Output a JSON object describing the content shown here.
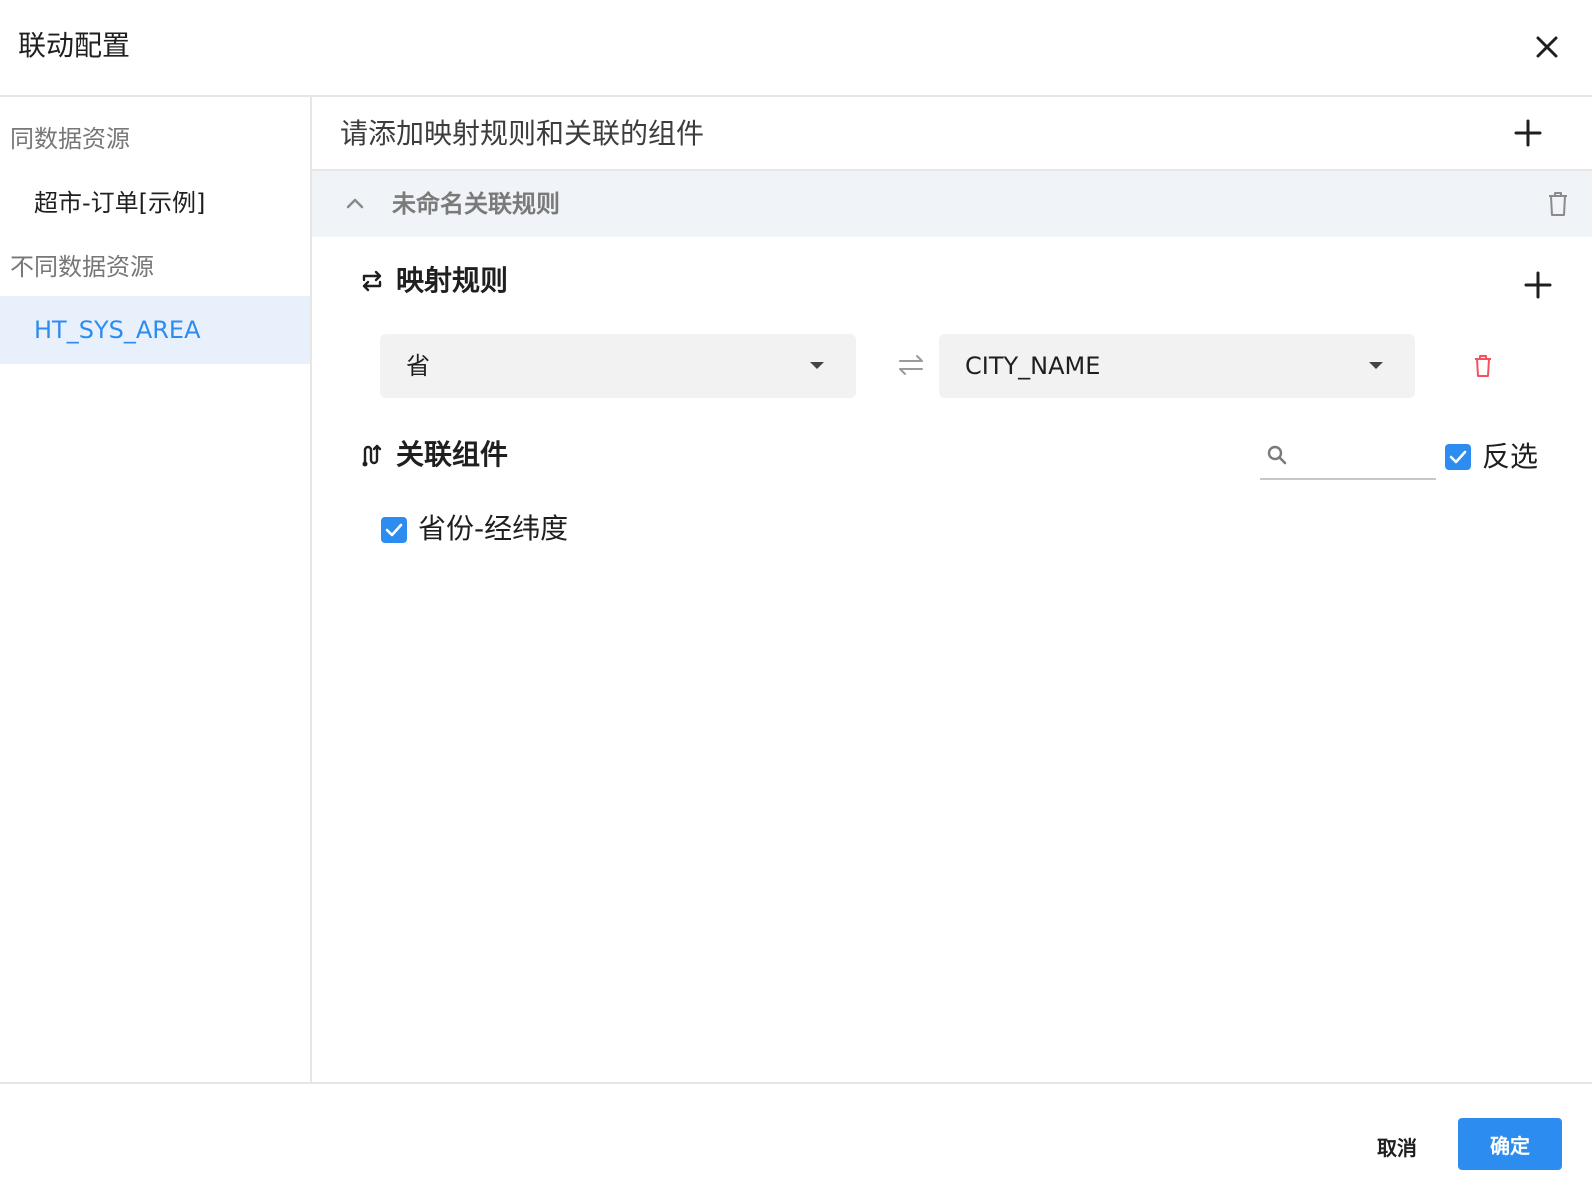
{
  "dialog": {
    "title": "联动配置"
  },
  "sidebar": {
    "same_group_label": "同数据资源",
    "same_items": [
      {
        "label": "超市-订单[示例]"
      }
    ],
    "diff_group_label": "不同数据资源",
    "diff_items": [
      {
        "label": "HT_SYS_AREA",
        "active": true
      }
    ]
  },
  "main": {
    "add_hint": "请添加映射规则和关联的组件",
    "rule": {
      "name": "未命名关联规则",
      "mapping_title": "映射规则",
      "mappings": [
        {
          "source": "省",
          "target": "CITY_NAME"
        }
      ],
      "linked_title": "关联组件",
      "search": {
        "value": "",
        "placeholder": ""
      },
      "invert_label": "反选",
      "invert_checked": true,
      "components": [
        {
          "label": "省份-经纬度",
          "checked": true
        }
      ]
    }
  },
  "footer": {
    "cancel_label": "取消",
    "ok_label": "确定"
  },
  "colors": {
    "accent": "#2d8cf0",
    "danger": "#f5515f",
    "active_bg": "#e8f1fb",
    "rule_header_bg": "#f0f4f8"
  }
}
